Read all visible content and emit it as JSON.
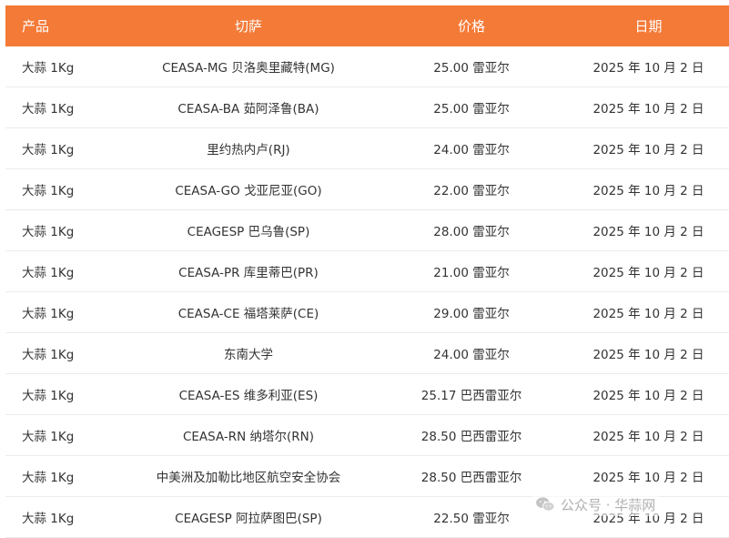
{
  "table": {
    "headers": [
      "产品",
      "切萨",
      "价格",
      "日期"
    ],
    "rows": [
      {
        "product": "大蒜 1Kg",
        "ceasa": "CEASA-MG 贝洛奥里藏特(MG)",
        "price": "25.00 雷亚尔",
        "date": "2025 年 10 月 2 日"
      },
      {
        "product": "大蒜 1Kg",
        "ceasa": "CEASA-BA 茹阿泽鲁(BA)",
        "price": "25.00 雷亚尔",
        "date": "2025 年 10 月 2 日"
      },
      {
        "product": "大蒜 1Kg",
        "ceasa": "里约热内卢(RJ)",
        "price": "24.00 雷亚尔",
        "date": "2025 年 10 月 2 日"
      },
      {
        "product": "大蒜 1Kg",
        "ceasa": "CEASA-GO 戈亚尼亚(GO)",
        "price": "22.00 雷亚尔",
        "date": "2025 年 10 月 2 日"
      },
      {
        "product": "大蒜 1Kg",
        "ceasa": "CEAGESP 巴乌鲁(SP)",
        "price": "28.00 雷亚尔",
        "date": "2025 年 10 月 2 日"
      },
      {
        "product": "大蒜 1Kg",
        "ceasa": "CEASA-PR 库里蒂巴(PR)",
        "price": "21.00 雷亚尔",
        "date": "2025 年 10 月 2 日"
      },
      {
        "product": "大蒜 1Kg",
        "ceasa": "CEASA-CE 福塔莱萨(CE)",
        "price": "29.00 雷亚尔",
        "date": "2025 年 10 月 2 日"
      },
      {
        "product": "大蒜 1Kg",
        "ceasa": "东南大学",
        "price": "24.00 雷亚尔",
        "date": "2025 年 10 月 2 日"
      },
      {
        "product": "大蒜 1Kg",
        "ceasa": "CEASA-ES 维多利亚(ES)",
        "price": "25.17 巴西雷亚尔",
        "date": "2025 年 10 月 2 日"
      },
      {
        "product": "大蒜 1Kg",
        "ceasa": "CEASA-RN 纳塔尔(RN)",
        "price": "28.50 巴西雷亚尔",
        "date": "2025 年 10 月 2 日"
      },
      {
        "product": "大蒜 1Kg",
        "ceasa": "中美洲及加勒比地区航空安全协会",
        "price": "28.50 巴西雷亚尔",
        "date": "2025 年 10 月 2 日"
      },
      {
        "product": "大蒜 1Kg",
        "ceasa": "CEAGESP 阿拉萨图巴(SP)",
        "price": "22.50 雷亚尔",
        "date": "2025 年 10 月 2 日"
      }
    ]
  },
  "watermark": {
    "text": "公众号 · 华蒜网",
    "icon": "wechat-icon"
  },
  "colors": {
    "header_bg": "#f47a37",
    "header_text": "#ffffff",
    "row_divider": "#ececec"
  }
}
